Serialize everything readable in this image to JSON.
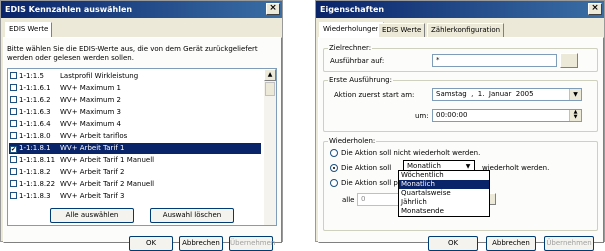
{
  "dialog1": {
    "title": "EDIS Kennzahlen auswählen",
    "close_glyph": "×",
    "tab": "EDIS Werte",
    "instruction_line1": "Bitte wählen Sie die EDIS-Werte aus, die von dem Gerät zurückgeliefert",
    "instruction_line2": "werden oder gelesen werden sollen.",
    "items": [
      {
        "code": "1-1:1.5",
        "label": "Lastprofil Wirkleistung",
        "checked": false
      },
      {
        "code": "1-1:1.6.1",
        "label": "WV+ Maximum 1",
        "checked": false
      },
      {
        "code": "1-1:1.6.2",
        "label": "WV+ Maximum 2",
        "checked": false
      },
      {
        "code": "1-1:1.6.3",
        "label": "WV+ Maximum 3",
        "checked": false
      },
      {
        "code": "1-1:1.6.4",
        "label": "WV+ Maximum 4",
        "checked": false
      },
      {
        "code": "1-1:1.8.0",
        "label": "WV+ Arbeit tariflos",
        "checked": false
      },
      {
        "code": "1-1:1.8.1",
        "label": "WV+ Arbeit Tarif 1",
        "checked": true
      },
      {
        "code": "1-1:1.8.11",
        "label": "WV+ Arbeit Tarif 1 Manuell",
        "checked": false
      },
      {
        "code": "1-1:1.8.2",
        "label": "WV+ Arbeit Tarif 2",
        "checked": false
      },
      {
        "code": "1-1:1.8.22",
        "label": "WV+ Arbeit Tarif 2 Manuell",
        "checked": false
      },
      {
        "code": "1-1:1.8.3",
        "label": "WV+ Arbeit Tarif 3",
        "checked": false
      }
    ],
    "select_all": "Alle auswählen",
    "clear_selection": "Auswahl löschen",
    "ok": "OK",
    "cancel": "Abbrechen",
    "apply": "Übernehmen"
  },
  "dialog2": {
    "title": "Eigenschaften",
    "close_glyph": "×",
    "tabs": [
      "Wiederholungen",
      "EDIS Werte",
      "Zählerkonfiguration"
    ],
    "group_target": "Zielrechner:",
    "label_executable": "Ausführbar auf:",
    "executable_value": "*",
    "group_first": "Erste Ausführung:",
    "label_start_on": "Aktion zuerst start am:",
    "date_value": "Samstag  ,  1.  Januar  2005",
    "label_time": "um:",
    "time_value": "00:00:00",
    "group_repeat": "Wiederholen:",
    "radio_no_repeat": "Die Aktion soll nicht wiederholt werden.",
    "radio_repeat": "Die Aktion soll",
    "repeat_value": "Monatlich",
    "repeat_suffix": "wiederholt werden.",
    "radio_periodic": "Die Aktion soll per",
    "label_every": "alle",
    "every_value": "0",
    "dropdown_options": [
      "Wöchentlich",
      "Monatlich",
      "Quartalsweise",
      "Jährlich",
      "Monatsende"
    ],
    "dropdown_selected_index": 1,
    "ok": "OK",
    "cancel": "Abbrechen",
    "apply": "Übernehmen"
  },
  "icons": {
    "arrow_up": "▲",
    "arrow_down": "▼",
    "check": "✔"
  }
}
